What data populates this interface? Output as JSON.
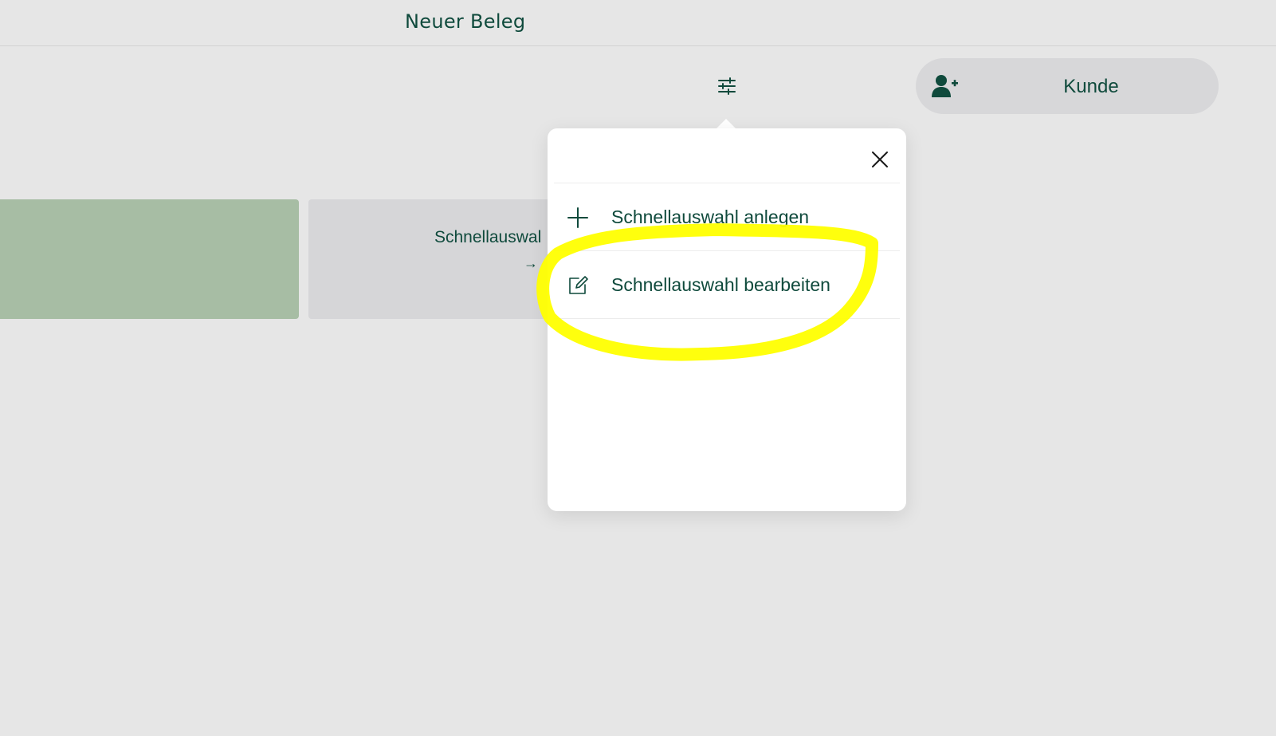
{
  "header": {
    "title": "Neuer Beleg"
  },
  "toolbar": {
    "filter_icon": "sliders-icon",
    "customer_button_label": "Kunde",
    "customer_icon": "add-user-icon"
  },
  "tiles": {
    "quick_select_label": "Schnellauswal",
    "quick_select_arrow": "→"
  },
  "popover": {
    "close_icon": "close-icon",
    "items": [
      {
        "label": "Schnellauswahl anlegen",
        "icon": "plus-icon"
      },
      {
        "label": "Schnellauswahl bearbeiten",
        "icon": "edit-icon"
      }
    ]
  },
  "colors": {
    "background": "#e6e6e6",
    "text": "#0f4a3c",
    "green_tile": "#a7bda4",
    "grey_tile": "#d6d6d8",
    "annotation_highlight": "#ffff00"
  }
}
